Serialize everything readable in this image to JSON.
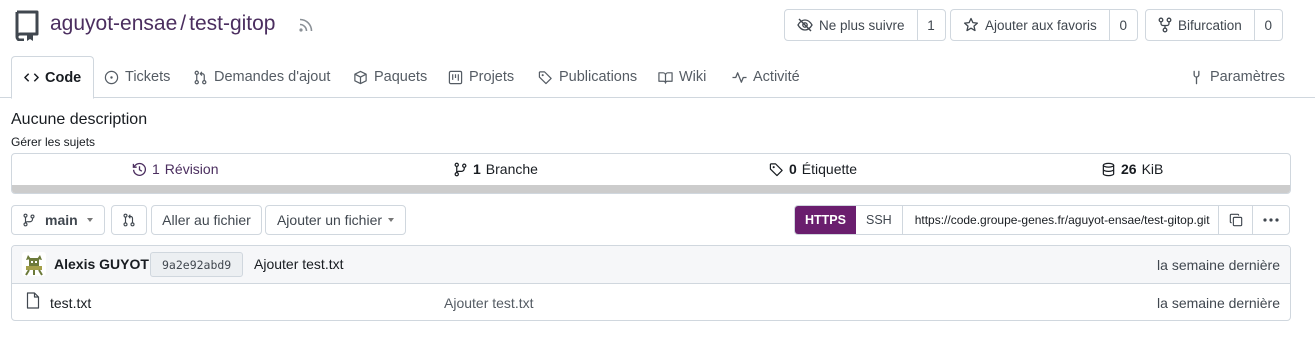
{
  "repo": {
    "owner": "aguyot-ensae",
    "separator": "/",
    "name": "test-gitop"
  },
  "header_buttons": {
    "watch": {
      "label": "Ne plus suivre",
      "count": "1"
    },
    "star": {
      "label": "Ajouter aux favoris",
      "count": "0"
    },
    "fork": {
      "label": "Bifurcation",
      "count": "0"
    }
  },
  "tabs": [
    {
      "label": "Code",
      "icon": "code-icon"
    },
    {
      "label": "Tickets",
      "icon": "issue-icon"
    },
    {
      "label": "Demandes d'ajout",
      "icon": "pull-request-icon"
    },
    {
      "label": "Paquets",
      "icon": "package-icon"
    },
    {
      "label": "Projets",
      "icon": "project-icon"
    },
    {
      "label": "Publications",
      "icon": "tag-icon"
    },
    {
      "label": "Wiki",
      "icon": "book-icon"
    },
    {
      "label": "Activité",
      "icon": "pulse-icon"
    },
    {
      "label": "Paramètres",
      "icon": "tool-icon"
    }
  ],
  "description": "Aucune description",
  "manage_topics": "Gérer les sujets",
  "stats": {
    "commits": {
      "count": "1",
      "label": "Révision"
    },
    "branches": {
      "count": "1",
      "label": "Branche"
    },
    "tags": {
      "count": "0",
      "label": "Étiquette"
    },
    "size": {
      "count": "26",
      "label": "KiB"
    }
  },
  "toolbar": {
    "branch": "main",
    "goto_file": "Aller au fichier",
    "add_file": "Ajouter un fichier"
  },
  "clone": {
    "https": "HTTPS",
    "ssh": "SSH",
    "url": "https://code.groupe-genes.fr/aguyot-ensae/test-gitop.git"
  },
  "latest_commit": {
    "author": "Alexis GUYOT",
    "sha": "9a2e92abd9",
    "message": "Ajouter test.txt",
    "when": "la semaine dernière"
  },
  "files": [
    {
      "name": "test.txt",
      "message": "Ajouter test.txt",
      "when": "la semaine dernière"
    }
  ],
  "colors": {
    "accent": "#4b2e5f",
    "https_bg": "#6a1e6e",
    "lang_bar": "#cccccc"
  }
}
